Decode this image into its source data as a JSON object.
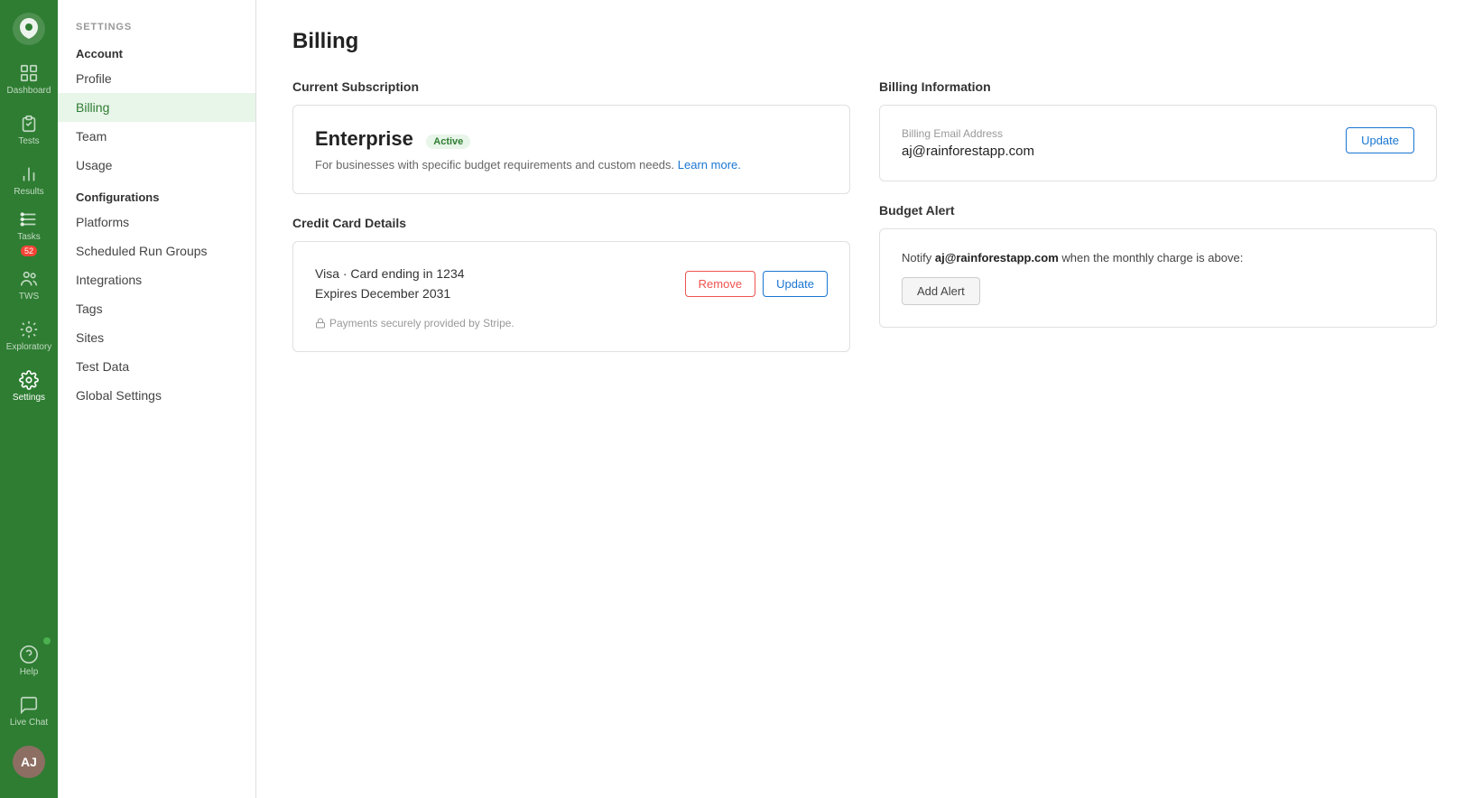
{
  "nav": {
    "items": [
      {
        "id": "dashboard",
        "label": "Dashboard",
        "icon": "grid"
      },
      {
        "id": "tests",
        "label": "Tests",
        "icon": "file-check"
      },
      {
        "id": "results",
        "label": "Results",
        "icon": "bar-chart"
      },
      {
        "id": "tasks",
        "label": "Tasks",
        "icon": "sliders",
        "badge": "52"
      },
      {
        "id": "tws",
        "label": "TWS",
        "icon": "users"
      },
      {
        "id": "exploratory",
        "label": "Exploratory",
        "icon": "bulb"
      },
      {
        "id": "settings",
        "label": "Settings",
        "icon": "gear",
        "active": true
      }
    ],
    "bottom": [
      {
        "id": "help",
        "label": "Help",
        "icon": "question",
        "dot": true
      },
      {
        "id": "live-chat",
        "label": "Live Chat",
        "icon": "chat"
      }
    ]
  },
  "sidebar": {
    "settings_label": "SETTINGS",
    "account_label": "Account",
    "profile_label": "Profile",
    "billing_label": "Billing",
    "team_label": "Team",
    "usage_label": "Usage",
    "configurations_label": "Configurations",
    "platforms_label": "Platforms",
    "scheduled_run_groups_label": "Scheduled Run Groups",
    "integrations_label": "Integrations",
    "tags_label": "Tags",
    "sites_label": "Sites",
    "test_data_label": "Test Data",
    "global_settings_label": "Global Settings"
  },
  "page": {
    "title": "Billing"
  },
  "current_subscription": {
    "section_title": "Current Subscription",
    "plan_name": "Enterprise",
    "badge": "Active",
    "description": "For businesses with specific budget requirements and custom needs.",
    "learn_more": "Learn more."
  },
  "credit_card": {
    "section_title": "Credit Card Details",
    "card_info": "Visa · Card ending in 1234",
    "expiry": "Expires December 2031",
    "stripe_note": "Payments securely provided by Stripe.",
    "remove_label": "Remove",
    "update_label": "Update"
  },
  "billing_info": {
    "section_title": "Billing Information",
    "email_label": "Billing Email Address",
    "email": "aj@rainforestapp.com",
    "update_label": "Update"
  },
  "budget_alert": {
    "section_title": "Budget Alert",
    "notify_text_prefix": "Notify",
    "notify_email": "aj@rainforestapp.com",
    "notify_text_suffix": "when the monthly charge is above:",
    "add_alert_label": "Add Alert"
  }
}
